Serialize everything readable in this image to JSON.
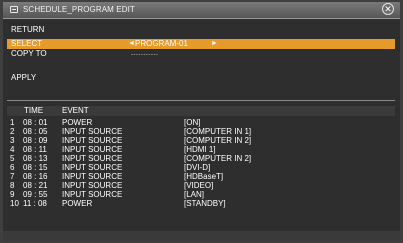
{
  "window": {
    "title": "SCHEDULE_PROGRAM EDIT",
    "title_icon": "calendar-icon",
    "close_symbol": "✕"
  },
  "menu": {
    "return_label": "RETURN",
    "select_label": "SELECT",
    "select_value": "PROGRAM-01",
    "arrow_left": "◄",
    "arrow_right": "►",
    "copy_to_label": "COPY TO",
    "copy_to_value": "-----------",
    "apply_label": "APPLY"
  },
  "colors": {
    "highlight": "#e69a2a",
    "background": "#2e2e2e",
    "title_bar": "#6a6a6a"
  },
  "table": {
    "headers": {
      "time": "TIME",
      "event": "EVENT"
    },
    "rows": [
      {
        "num": "1",
        "time": "08 : 01",
        "event": "POWER",
        "param": "[ON]"
      },
      {
        "num": "2",
        "time": "08 : 05",
        "event": "INPUT SOURCE",
        "param": "[COMPUTER IN 1]"
      },
      {
        "num": "3",
        "time": "08 : 09",
        "event": "INPUT SOURCE",
        "param": "[COMPUTER IN 2]"
      },
      {
        "num": "4",
        "time": "08 : 11",
        "event": "INPUT SOURCE",
        "param": "[HDMI 1]"
      },
      {
        "num": "5",
        "time": "08 : 13",
        "event": "INPUT SOURCE",
        "param": "[COMPUTER IN 2]"
      },
      {
        "num": "6",
        "time": "08 : 15",
        "event": "INPUT SOURCE",
        "param": "[DVI-D]"
      },
      {
        "num": "7",
        "time": "08 : 16",
        "event": "INPUT SOURCE",
        "param": "[HDBaseT]"
      },
      {
        "num": "8",
        "time": "08 : 21",
        "event": "INPUT SOURCE",
        "param": "[VIDEO]"
      },
      {
        "num": "9",
        "time": "09 : 55",
        "event": "INPUT SOURCE",
        "param": "[LAN]"
      },
      {
        "num": "10",
        "time": "11 : 08",
        "event": "POWER",
        "param": "[STANDBY]"
      }
    ]
  }
}
